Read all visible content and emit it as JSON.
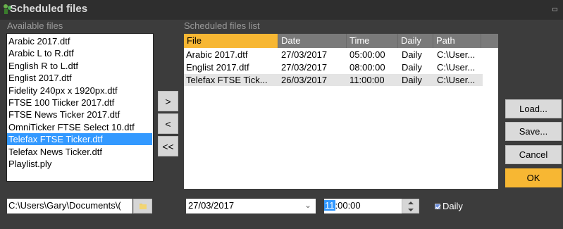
{
  "window": {
    "title": "Scheduled files"
  },
  "available": {
    "label": "Available files",
    "items": [
      "Arabic 2017.dtf",
      "Arabic L to R.dtf",
      "English R to L.dtf",
      "Englist 2017.dtf",
      "Fidelity 240px x 1920px.dtf",
      "FTSE 100 Tiicker 2017.dtf",
      "FTSE News Ticker 2017.dtf",
      "OmniTicker FTSE Select 10.dtf",
      "Telefax FTSE Ticker.dtf",
      "Telefax News Ticker.dtf",
      "Playlist.ply"
    ],
    "selected_index": 8
  },
  "move_buttons": {
    "add": ">",
    "remove": "<",
    "remove_all": "<<"
  },
  "scheduled": {
    "label": "Scheduled files list",
    "columns": [
      "File",
      "Date",
      "Time",
      "Daily",
      "Path"
    ],
    "rows": [
      [
        "Arabic 2017.dtf",
        "27/03/2017",
        "05:00:00",
        "Daily",
        "C:\\User..."
      ],
      [
        "Englist 2017.dtf",
        "27/03/2017",
        "08:00:00",
        "Daily",
        "C:\\User..."
      ],
      [
        "Telefax FTSE Tick...",
        "26/03/2017",
        "11:00:00",
        "Daily",
        "C:\\User..."
      ]
    ],
    "selected_row": 2
  },
  "buttons": {
    "load": "Load...",
    "save": "Save...",
    "cancel": "Cancel",
    "ok": "OK"
  },
  "path_field": {
    "value": "C:\\Users\\Gary\\Documents\\("
  },
  "date_field": {
    "value": "27/03/2017"
  },
  "time_field": {
    "hour": "11",
    "rest": ":00:00"
  },
  "daily_checkbox": {
    "label": "Daily",
    "checked": true
  },
  "colors": {
    "accent": "#f7b733",
    "selection": "#3399ff",
    "background": "#3c3c3c"
  }
}
